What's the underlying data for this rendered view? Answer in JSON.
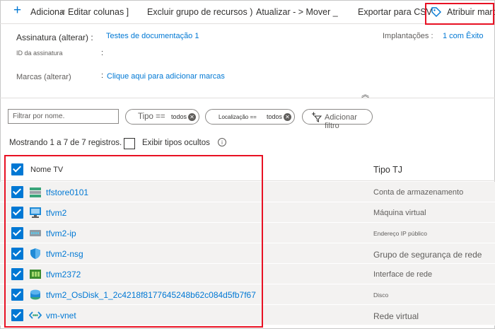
{
  "toolbar": {
    "add_label": "Adiciona",
    "edit_columns_label": "Editar colunas ]",
    "delete_group_label": "Excluir grupo de recursos )",
    "refresh_move_label": "Atualizar - > Mover _",
    "export_label": "Exportar para CSV",
    "assign_label": "Atribuir marc"
  },
  "essentials": {
    "subscription_label": "Assinatura (alterar) :",
    "subscription_value": "Testes de documentação 1",
    "subscription_id_label": "ID da assinatura",
    "tags_label": "Marcas (alterar)",
    "tags_value": "Clique aqui para adicionar marcas",
    "deployments_label": "Implantações :",
    "deployments_value": "1 com Êxito"
  },
  "filters": {
    "search_placeholder": "Filtrar por nome.",
    "type_label": "Tipo ==",
    "type_value": "todos",
    "location_label": "Localização ==",
    "location_value": "todos",
    "add_filter_label": "Adicionar filtro"
  },
  "records": {
    "summary": "Mostrando 1 a 7 de 7 registros.",
    "show_hidden_label": "Exibir tipos ocultos"
  },
  "table": {
    "col_name": "Nome TV",
    "col_type": "Tipo TJ",
    "rows": [
      {
        "name": "tfstore0101",
        "type": "Conta de armazenamento"
      },
      {
        "name": "tfvm2",
        "type": "Máquina virtual"
      },
      {
        "name": "tfvm2-ip",
        "type": "Endereço IP público"
      },
      {
        "name": "tfvm2-nsg",
        "type": "Grupo de segurança de rede"
      },
      {
        "name": "tfvm2372",
        "type": "Interface de rede"
      },
      {
        "name": "tfvm2_OsDisk_1_2c4218f8177645248b62c084d5fb7f67",
        "type": "Disco"
      },
      {
        "name": "vm-vnet",
        "type": "Rede virtual"
      }
    ]
  },
  "colors": {
    "accent": "#0078d4",
    "highlight": "#e81123",
    "row_bg": "#f3f2f1"
  }
}
